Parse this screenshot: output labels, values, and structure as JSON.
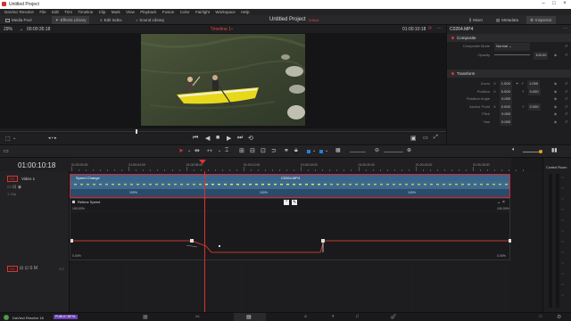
{
  "window": {
    "title": "Untitled Project"
  },
  "menu": [
    "DaVinci Resolve",
    "File",
    "Edit",
    "Trim",
    "Timeline",
    "Clip",
    "Mark",
    "View",
    "Playback",
    "Fusion",
    "Color",
    "Fairlight",
    "Workspace",
    "Help"
  ],
  "toolbar": {
    "media_pool": "Media Pool",
    "effects_library": "Effects Library",
    "edit_index": "Edit Index",
    "sound_library": "Sound Library",
    "project_name": "Untitled Project",
    "project_status": "Edited",
    "mixer": "Mixer",
    "metadata": "Metadata",
    "inspector": "Inspector"
  },
  "viewer": {
    "zoom": "29%",
    "source_tc": "00:00:35:18",
    "timeline_name": "Timeline 1",
    "record_tc": "01:00:10:18"
  },
  "inspector": {
    "clip_name": "C0264.MP4",
    "composite": {
      "title": "Composite",
      "mode_label": "Composite Mode",
      "mode_value": "Normal",
      "opacity_label": "Opacity",
      "opacity_value": "100.00"
    },
    "transform": {
      "title": "Transform",
      "rows": [
        {
          "label": "Zoom",
          "x_label": "X",
          "x": "1.000",
          "y_label": "Y",
          "y": "1.000"
        },
        {
          "label": "Position",
          "x_label": "X",
          "x": "0.000",
          "y_label": "Y",
          "y": "0.000"
        },
        {
          "label": "Rotation Angle",
          "x_label": "",
          "x": "0.000",
          "y_label": "",
          "y": ""
        },
        {
          "label": "Anchor Point",
          "x_label": "X",
          "x": "0.000",
          "y_label": "Y",
          "y": "0.000"
        },
        {
          "label": "Pitch",
          "x_label": "",
          "x": "0.000",
          "y_label": "",
          "y": ""
        },
        {
          "label": "Yaw",
          "x_label": "",
          "x": "0.000",
          "y_label": "",
          "y": ""
        }
      ]
    }
  },
  "timeline": {
    "timecode": "01:00:10:18",
    "ruler_marks": [
      "01:00:00:00",
      "01:00:04:00",
      "01:00:08:00",
      "01:00:12:00",
      "01:00:16:00",
      "01:00:20:00",
      "01:00:24:00",
      "01:00:28:00"
    ],
    "video_track": {
      "badge": "V1",
      "name": "Video 1",
      "clip_count": "1 Clip"
    },
    "audio_track": {
      "badge": "A1",
      "level": "2.0"
    },
    "clip": {
      "speed_label": "Speed Change",
      "name": "C0264.MP4",
      "speed_values": [
        "100%",
        "100%",
        "100%"
      ]
    },
    "retime": {
      "title": "Retime Speed",
      "top_left": "100.00%",
      "top_right": "100.00%",
      "bottom_left": "0.00%",
      "bottom_right": "0.00%"
    },
    "control_room": "Control Room"
  },
  "statusbar": {
    "app": "DaVinci Resolve 16",
    "badge": "PUBLIC BETA"
  },
  "colors": {
    "accent_red": "#d23333",
    "clip_blue": "#2a4b6a",
    "playhead": "#e03030",
    "curve": "#c0392b"
  }
}
